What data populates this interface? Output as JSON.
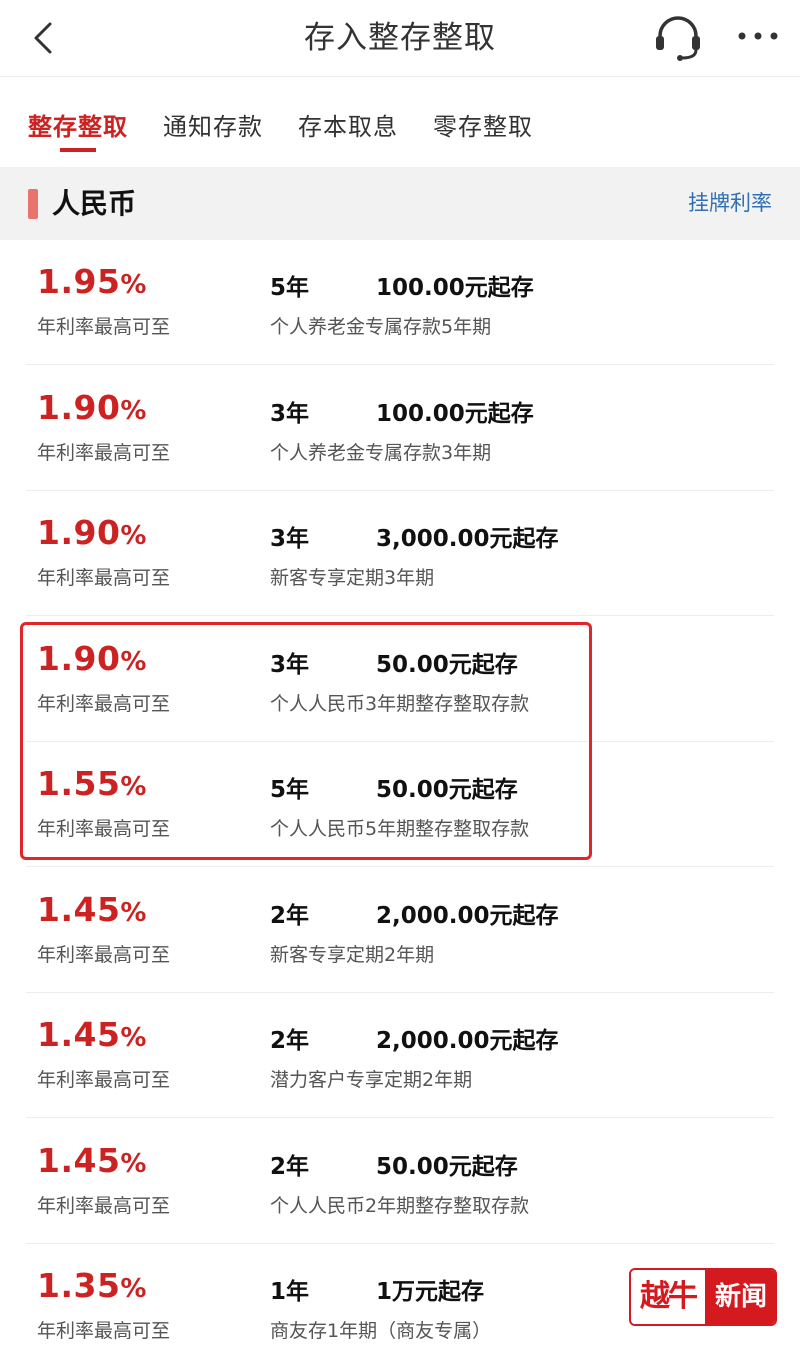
{
  "header": {
    "title": "存入整存整取",
    "back_icon": "chevron-left-icon",
    "service_icon": "headset-icon",
    "more_icon": "more-dots-icon"
  },
  "tabs": [
    {
      "label": "整存整取",
      "active": true
    },
    {
      "label": "通知存款",
      "active": false
    },
    {
      "label": "存本取息",
      "active": false
    },
    {
      "label": "零存整取",
      "active": false
    }
  ],
  "section": {
    "currency": "人民币",
    "rates_link": "挂牌利率"
  },
  "products": [
    {
      "rate": "1.95",
      "unit": "%",
      "rate_label": "年利率最高可至",
      "term": "5年",
      "min_amount": "100.00元起存",
      "description": "个人养老金专属存款5年期"
    },
    {
      "rate": "1.90",
      "unit": "%",
      "rate_label": "年利率最高可至",
      "term": "3年",
      "min_amount": "100.00元起存",
      "description": "个人养老金专属存款3年期"
    },
    {
      "rate": "1.90",
      "unit": "%",
      "rate_label": "年利率最高可至",
      "term": "3年",
      "min_amount": "3,000.00元起存",
      "description": "新客专享定期3年期"
    },
    {
      "rate": "1.90",
      "unit": "%",
      "rate_label": "年利率最高可至",
      "term": "3年",
      "min_amount": "50.00元起存",
      "description": "个人人民币3年期整存整取存款"
    },
    {
      "rate": "1.55",
      "unit": "%",
      "rate_label": "年利率最高可至",
      "term": "5年",
      "min_amount": "50.00元起存",
      "description": "个人人民币5年期整存整取存款"
    },
    {
      "rate": "1.45",
      "unit": "%",
      "rate_label": "年利率最高可至",
      "term": "2年",
      "min_amount": "2,000.00元起存",
      "description": "新客专享定期2年期"
    },
    {
      "rate": "1.45",
      "unit": "%",
      "rate_label": "年利率最高可至",
      "term": "2年",
      "min_amount": "2,000.00元起存",
      "description": "潜力客户专享定期2年期"
    },
    {
      "rate": "1.45",
      "unit": "%",
      "rate_label": "年利率最高可至",
      "term": "2年",
      "min_amount": "50.00元起存",
      "description": "个人人民币2年期整存整取存款"
    },
    {
      "rate": "1.35",
      "unit": "%",
      "rate_label": "年利率最高可至",
      "term": "1年",
      "min_amount": "1万元起存",
      "description": "商友存1年期（商友专属）"
    }
  ],
  "watermark": {
    "logo_left": "越牛",
    "logo_right": "新闻"
  },
  "colors": {
    "accent": "#cc2222",
    "link": "#2f6fb5",
    "highlight_border": "#e0262a",
    "section_bg": "#f2f2f2"
  }
}
